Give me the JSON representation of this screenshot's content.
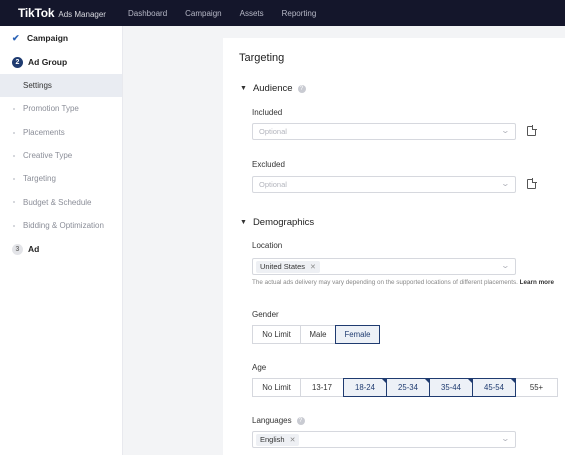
{
  "topbar": {
    "logo": "TikTok",
    "product": "Ads Manager",
    "nav": [
      "Dashboard",
      "Campaign",
      "Assets",
      "Reporting"
    ]
  },
  "sidebar": {
    "campaign": "Campaign",
    "adgroup_num": "2",
    "adgroup": "Ad Group",
    "subitems": [
      "Settings",
      "Promotion Type",
      "Placements",
      "Creative Type",
      "Targeting",
      "Budget & Schedule",
      "Bidding & Optimization"
    ],
    "ad_num": "3",
    "ad": "Ad"
  },
  "panel": {
    "title": "Targeting",
    "audience": {
      "heading": "Audience",
      "included_label": "Included",
      "included_placeholder": "Optional",
      "excluded_label": "Excluded",
      "excluded_placeholder": "Optional"
    },
    "demographics": {
      "heading": "Demographics",
      "location_label": "Location",
      "location_value": "United States",
      "hint": "The actual ads delivery may vary depending on the supported locations of different placements.",
      "hint_link": "Learn more",
      "gender_label": "Gender",
      "gender_options": [
        "No Limit",
        "Male",
        "Female"
      ],
      "gender_selected": "Female",
      "age_label": "Age",
      "age_options": [
        "No Limit",
        "13-17",
        "18-24",
        "25-34",
        "35-44",
        "45-54",
        "55+"
      ],
      "age_selected": [
        "18-24",
        "25-34",
        "35-44",
        "45-54"
      ],
      "languages_label": "Languages",
      "language_value": "English"
    }
  }
}
